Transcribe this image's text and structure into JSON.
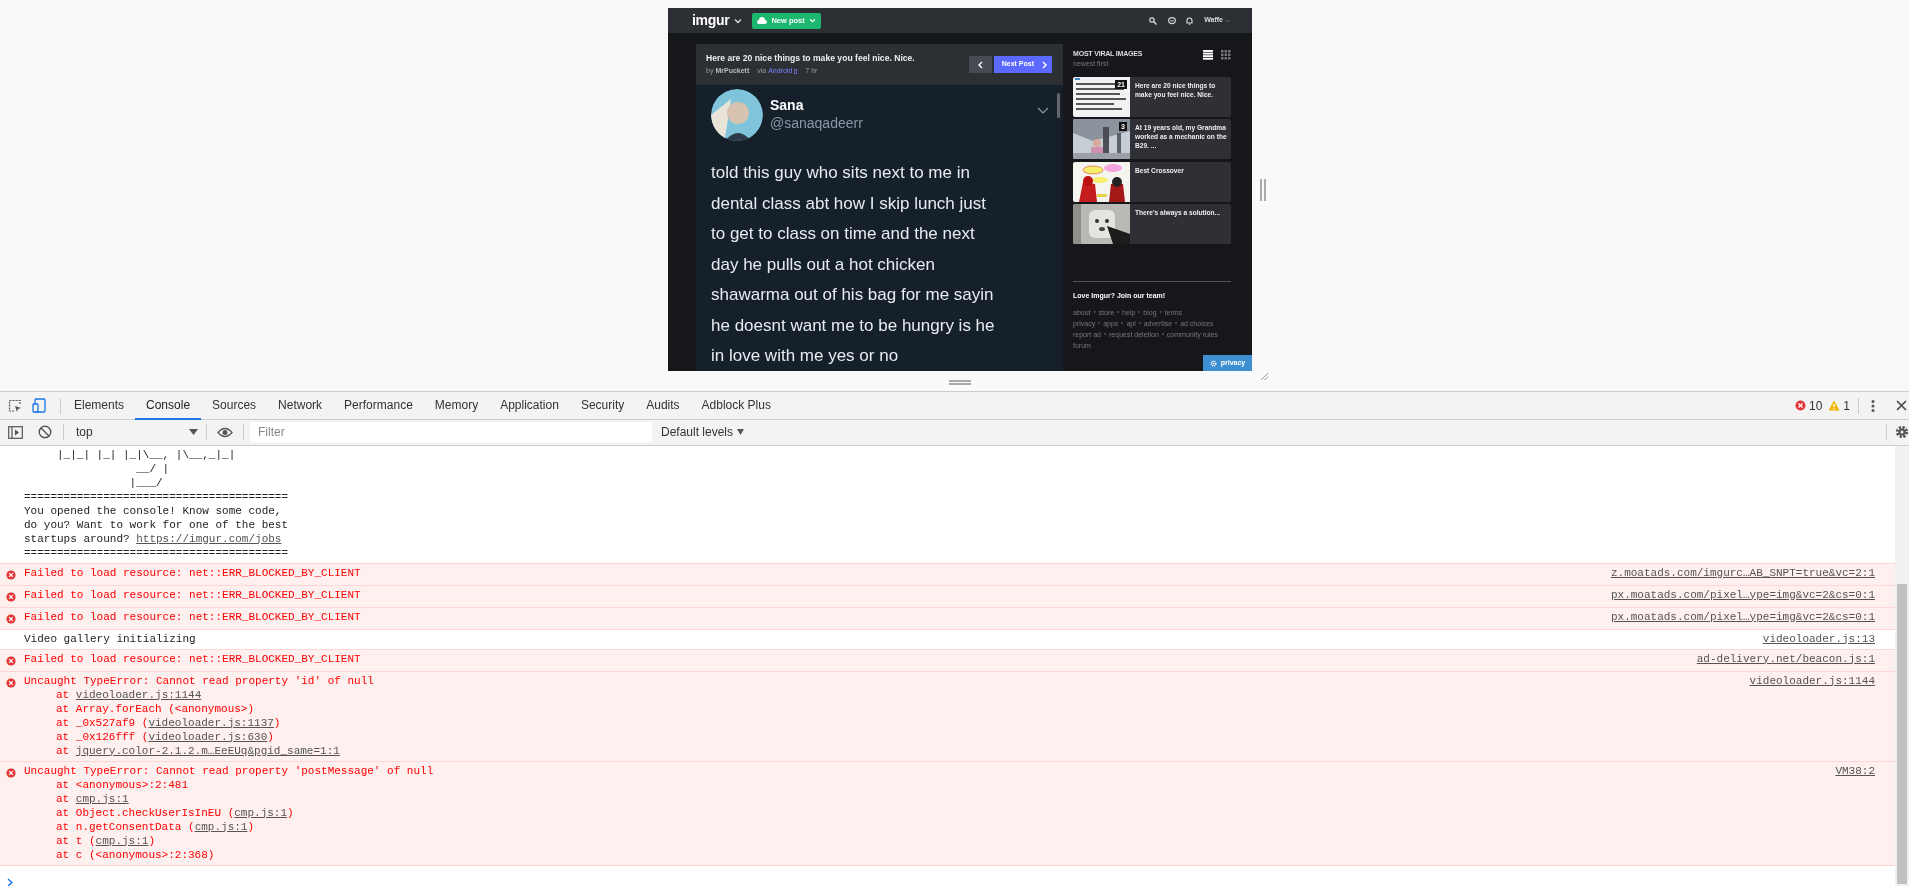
{
  "page_preview": {
    "navbar": {
      "logo": "imgur",
      "new_post": "New post",
      "user": "Waffe"
    },
    "post": {
      "title": "Here are 20 nice things to make you feel nice. Nice.",
      "by": "by",
      "author": "MrPuckett",
      "via": "via",
      "platform": "Android",
      "age": "7 hr",
      "next": "Next Post"
    },
    "tweet": {
      "name": "Sana",
      "handle": "@sanaqadeerr",
      "lines": [
        "told this guy who sits next to me in",
        "dental class abt how I skip lunch just",
        "to get to class on time and the next",
        "day he pulls out a hot chicken",
        "shawarma out of his bag for me sayin",
        "he doesnt want me to be hungry is he",
        "in love with me yes or no"
      ]
    },
    "sidebar": {
      "heading": "MOST VIRAL IMAGES",
      "sort": "newest first",
      "views": [
        {
          "kind": "list",
          "selected": true
        },
        {
          "kind": "grid",
          "selected": false
        }
      ],
      "items": [
        {
          "title": "Here are 20 nice things to make you feel nice. Nice.",
          "count": "21"
        },
        {
          "title": "At 19 years old, my Grandma worked as a mechanic on the B29. ...",
          "count": "3"
        },
        {
          "title": "Best Crossover"
        },
        {
          "title": "There's always a solution..."
        }
      ],
      "join": "Love Imgur? Join our team!",
      "footer_links": [
        [
          "about",
          "store",
          "help",
          "blog",
          "terms"
        ],
        [
          "privacy",
          "apps",
          "api",
          "advertise",
          "ad choices"
        ],
        [
          "report ad",
          "request deletion",
          "community rules"
        ],
        [
          "forum"
        ]
      ],
      "privacy": "privacy"
    }
  },
  "devtools": {
    "tabs": [
      {
        "label": "Elements",
        "selected": false
      },
      {
        "label": "Console",
        "selected": true
      },
      {
        "label": "Sources",
        "selected": false
      },
      {
        "label": "Network",
        "selected": false
      },
      {
        "label": "Performance",
        "selected": false
      },
      {
        "label": "Memory",
        "selected": false
      },
      {
        "label": "Application",
        "selected": false
      },
      {
        "label": "Security",
        "selected": false
      },
      {
        "label": "Audits",
        "selected": false
      },
      {
        "label": "Adblock Plus",
        "selected": false
      }
    ],
    "errors": "10",
    "warnings": "1",
    "context": "top",
    "filter_placeholder": "Filter",
    "levels": "Default levels"
  },
  "console": [
    {
      "kind": "log",
      "lines": [
        {
          "before": "     |_|_| |_| |_|\\__, |\\__,_|_|"
        },
        {
          "before": "                 __/ |"
        },
        {
          "before": "                |___/"
        },
        {
          "before": "========================================"
        },
        {
          "before": "You opened the console! Know some code,"
        },
        {
          "before": "do you? Want to work for one of the best"
        },
        {
          "before": "startups around? ",
          "link": "https://imgur.com/jobs"
        },
        {
          "before": "========================================"
        }
      ]
    },
    {
      "kind": "error",
      "lines": [
        {
          "before": "Failed to load resource: net::ERR_BLOCKED_BY_CLIENT"
        }
      ],
      "source": "z.moatads.com/imgurc…AB_SNPT=true&vc=2:1"
    },
    {
      "kind": "error",
      "lines": [
        {
          "before": "Failed to load resource: net::ERR_BLOCKED_BY_CLIENT"
        }
      ],
      "source": "px.moatads.com/pixel…ype=img&vc=2&cs=0:1"
    },
    {
      "kind": "error",
      "lines": [
        {
          "before": "Failed to load resource: net::ERR_BLOCKED_BY_CLIENT"
        }
      ],
      "source": "px.moatads.com/pixel…ype=img&vc=2&cs=0:1"
    },
    {
      "kind": "log",
      "lines": [
        {
          "before": "Video gallery initializing"
        }
      ],
      "source": "videoloader.js:13"
    },
    {
      "kind": "error",
      "lines": [
        {
          "before": "Failed to load resource: net::ERR_BLOCKED_BY_CLIENT"
        }
      ],
      "source": "ad-delivery.net/beacon.js:1"
    },
    {
      "kind": "error",
      "lines": [
        {
          "before": "Uncaught TypeError: Cannot read property 'id' of null"
        }
      ],
      "source": "videoloader.js:1144",
      "frames": [
        {
          "before": "at ",
          "link": "videoloader.js:1144"
        },
        {
          "before": "at Array.forEach (<anonymous>)"
        },
        {
          "before": "at _0x527af9 (",
          "link": "videoloader.js:1137",
          "after": ")"
        },
        {
          "before": "at _0x126fff (",
          "link": "videoloader.js:630",
          "after": ")"
        },
        {
          "before": "at ",
          "link": "jquery.color-2.1.2.m…EeEUq&pgid_same=1:1"
        }
      ]
    },
    {
      "kind": "error",
      "lines": [
        {
          "before": "Uncaught TypeError: Cannot read property 'postMessage' of null"
        }
      ],
      "source": "VM38:2",
      "frames": [
        {
          "before": "at <anonymous>:2:481"
        },
        {
          "before": "at ",
          "link": "cmp.js:1"
        },
        {
          "before": "at Object.checkUserIsInEU (",
          "link": "cmp.js:1",
          "after": ")"
        },
        {
          "before": "at n.getConsentData (",
          "link": "cmp.js:1",
          "after": ")"
        },
        {
          "before": "at t (",
          "link": "cmp.js:1",
          "after": ")"
        },
        {
          "before": "at c (<anonymous>:2:368)"
        }
      ]
    }
  ]
}
